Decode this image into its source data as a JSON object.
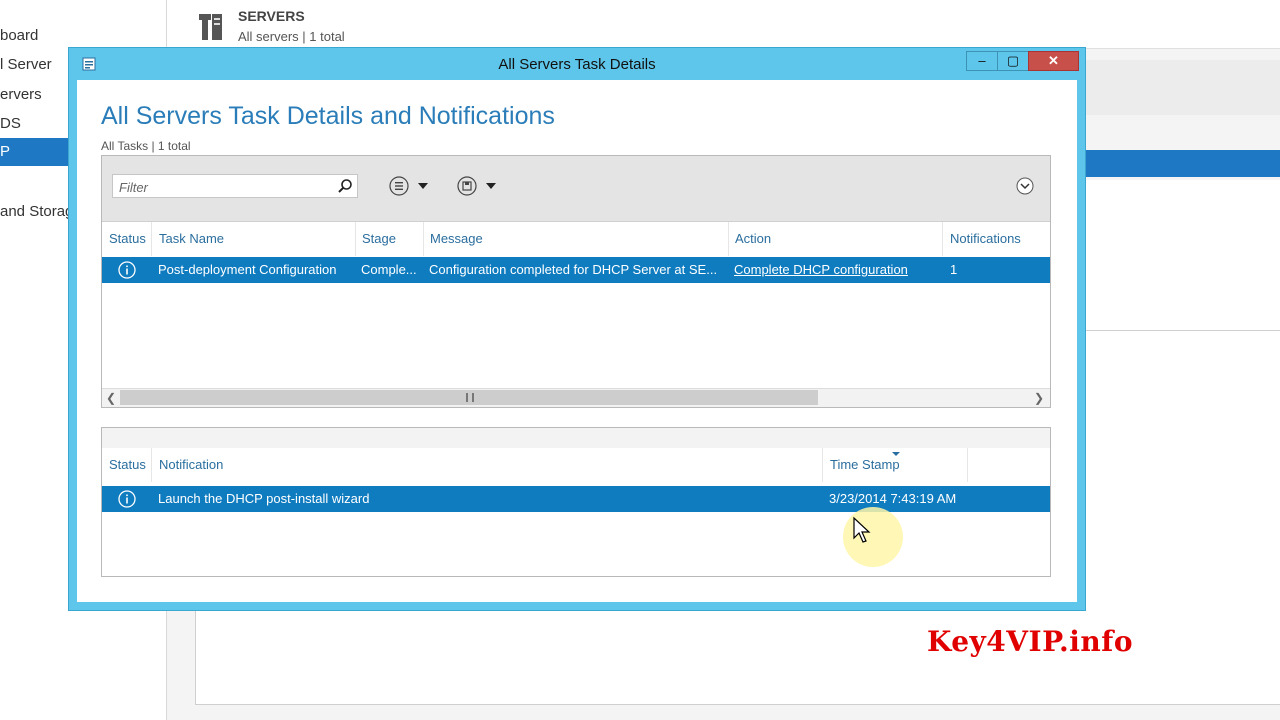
{
  "background": {
    "sidebar_items": [
      "board",
      "l Server",
      "ervers",
      "DS",
      "P",
      "and Storag"
    ],
    "selected_index": 4,
    "header": {
      "title": "SERVERS",
      "subtitle": "All servers | 1 total"
    }
  },
  "dialog": {
    "title": "All Servers Task Details",
    "buttons": {
      "minimize": "–",
      "maximize": "▢",
      "close": "✕"
    },
    "heading": "All Servers Task Details and Notifications",
    "count": "All Tasks | 1 total",
    "filter": {
      "placeholder": "Filter",
      "value": ""
    },
    "tasks": {
      "columns": [
        "Status",
        "Task Name",
        "Stage",
        "Message",
        "Action",
        "Notifications"
      ],
      "rows": [
        {
          "status_icon": "info-icon",
          "task_name": "Post-deployment Configuration",
          "stage": "Comple...",
          "message": "Configuration completed for DHCP Server at SE...",
          "action": "Complete DHCP configuration",
          "notifications": "1"
        }
      ]
    },
    "notifications": {
      "columns": [
        "Status",
        "Notification",
        "Time Stamp"
      ],
      "rows": [
        {
          "status_icon": "info-icon",
          "notification": "Launch the DHCP post-install wizard",
          "timestamp": "3/23/2014 7:43:19 AM"
        }
      ]
    }
  },
  "watermark": "Key4VIP.info",
  "colors": {
    "accent": "#0f7cc0",
    "titlebar": "#5ec6ea",
    "heading": "#2a7db8",
    "close": "#c7504a",
    "watermark": "#e00000"
  }
}
